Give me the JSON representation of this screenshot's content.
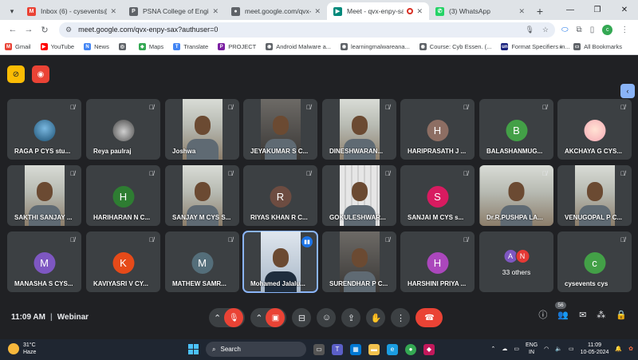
{
  "browser": {
    "tabs": [
      {
        "title": "Inbox (6) - cysevents@psnacet",
        "icon": "gmail-icon",
        "color": "#ea4335",
        "glyph": "M"
      },
      {
        "title": "PSNA College of Engineering",
        "icon": "website-icon",
        "color": "#5f6368",
        "glyph": "P"
      },
      {
        "title": "meet.google.com/qvx-enpy",
        "icon": "globe-icon",
        "color": "#5f6368",
        "glyph": "●"
      },
      {
        "title": "Meet - qvx-enpy-sax",
        "icon": "meet-icon",
        "color": "#00897b",
        "glyph": "▶",
        "active": true
      },
      {
        "title": "(3) WhatsApp",
        "icon": "whatsapp-icon",
        "color": "#25d366",
        "glyph": "✆"
      }
    ],
    "url": "meet.google.com/qvx-enpy-sax?authuser=0",
    "profile_initial": "c",
    "bookmarks": [
      {
        "label": "Gmail",
        "color": "#ea4335",
        "glyph": "M"
      },
      {
        "label": "YouTube",
        "color": "#ff0000",
        "glyph": "▶"
      },
      {
        "label": "News",
        "color": "#4285f4",
        "glyph": "N"
      },
      {
        "label": "",
        "color": "#5f6368",
        "glyph": "◎"
      },
      {
        "label": "Maps",
        "color": "#34a853",
        "glyph": "◆"
      },
      {
        "label": "Translate",
        "color": "#4285f4",
        "glyph": "T"
      },
      {
        "label": "PROJECT",
        "color": "#7b1fa2",
        "glyph": "P"
      },
      {
        "label": "Android Malware a...",
        "color": "#5f6368",
        "glyph": "◉"
      },
      {
        "label": "learningmalwareana...",
        "color": "#5f6368",
        "glyph": "◉"
      },
      {
        "label": "Course: Cyb Essen. (...",
        "color": "#5f6368",
        "glyph": "◉"
      },
      {
        "label": "Format Specifiers In...",
        "color": "#1a237e",
        "glyph": "un"
      }
    ],
    "all_bookmarks": "All Bookmarks"
  },
  "meet": {
    "participants": [
      {
        "name": "RAGA P CYS stu...",
        "type": "photo",
        "bg": "photo"
      },
      {
        "name": "Reya paulraj",
        "type": "photo",
        "bg": "photo2"
      },
      {
        "name": "Joshwa",
        "type": "video",
        "bg": ""
      },
      {
        "name": "JEYAKUMAR S C...",
        "type": "video",
        "bg": "dark"
      },
      {
        "name": "DINESHWARAN...",
        "type": "video",
        "bg": ""
      },
      {
        "name": "HARIPRASATH J ...",
        "type": "initial",
        "initial": "H",
        "color": "#8d6e63"
      },
      {
        "name": "BALASHANMUG...",
        "type": "initial",
        "initial": "B",
        "color": "#43a047"
      },
      {
        "name": "AKCHAYA G CYS...",
        "type": "photo",
        "bg": "photo3"
      },
      {
        "name": "SAKTHI SANJAY ...",
        "type": "video",
        "bg": ""
      },
      {
        "name": "HARIHARAN N C...",
        "type": "initial",
        "initial": "H",
        "color": "#2e7d32"
      },
      {
        "name": "SANJAY M CYS S...",
        "type": "video",
        "bg": ""
      },
      {
        "name": "RIYAS KHAN R C...",
        "type": "initial",
        "initial": "R",
        "color": "#6d4c41"
      },
      {
        "name": "GOKULESHWAR...",
        "type": "video",
        "bg": "stripe"
      },
      {
        "name": "SANJAI M CYS s...",
        "type": "initial",
        "initial": "S",
        "color": "#d81b60"
      },
      {
        "name": "Dr.R.PUSHPA LA...",
        "type": "video",
        "bg": "wide"
      },
      {
        "name": "VENUGOPAL P C...",
        "type": "video",
        "bg": ""
      },
      {
        "name": "MANASHA S CYS...",
        "type": "initial",
        "initial": "M",
        "color": "#7e57c2"
      },
      {
        "name": "KAVIYASRI V CY...",
        "type": "initial",
        "initial": "K",
        "color": "#e64a19"
      },
      {
        "name": "MATHEW SAMR...",
        "type": "initial",
        "initial": "M",
        "color": "#546e7a"
      },
      {
        "name": "Mohamed Jalalu...",
        "type": "video",
        "bg": "blue",
        "speaking": true
      },
      {
        "name": "SURENDHAR P C...",
        "type": "video",
        "bg": "dark"
      },
      {
        "name": "HARSHINI PRIYA ...",
        "type": "initial",
        "initial": "H",
        "color": "#ab47bc"
      },
      {
        "name": "33 others",
        "type": "others",
        "initials": [
          "A",
          "N"
        ],
        "colors": [
          "#7e57c2",
          "#e53935"
        ]
      },
      {
        "name": "cysevents cys",
        "type": "initial",
        "initial": "c",
        "color": "#43a047",
        "self": true
      }
    ],
    "time": "11:09 AM",
    "meeting_name": "Webinar",
    "participant_count": "56"
  },
  "taskbar": {
    "temp": "31°C",
    "weather": "Haze",
    "search_placeholder": "Search",
    "lang1": "ENG",
    "lang2": "IN",
    "time": "11:09",
    "date": "10-05-2024"
  }
}
